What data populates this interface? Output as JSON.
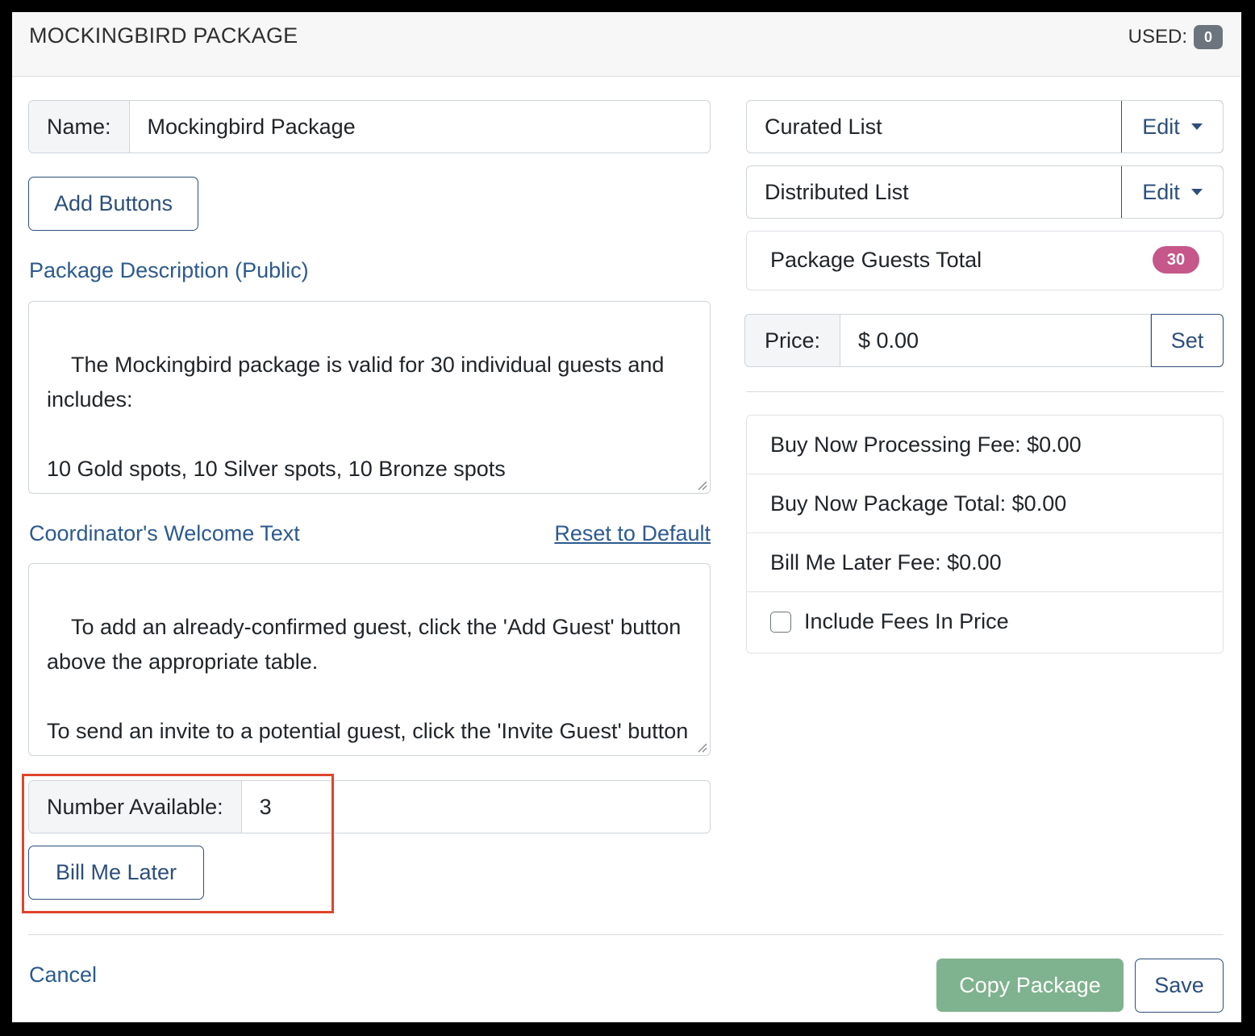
{
  "header": {
    "title": "MOCKINGBIRD PACKAGE",
    "used_label": "USED:",
    "used_count": "0"
  },
  "name_field": {
    "label": "Name:",
    "value": "Mockingbird Package"
  },
  "add_buttons_label": "Add Buttons",
  "description": {
    "label": "Package Description (Public)",
    "text": "The Mockingbird package is valid for 30 individual guests and includes:\n\n10 Gold spots, 10 Silver spots, 10 Bronze spots"
  },
  "welcome": {
    "label": "Coordinator's Welcome Text",
    "reset_label": "Reset to Default",
    "text": "To add an already-confirmed guest, click the 'Add Guest' button above the appropriate table.\n\nTo send an invite to a potential guest, click the 'Invite Guest' button above the appropriate table. The guest will receive an"
  },
  "number_available": {
    "label": "Number Available:",
    "value": "3"
  },
  "bill_me_later_label": "Bill Me Later",
  "lists": {
    "curated": {
      "label": "Curated List",
      "edit_label": "Edit"
    },
    "distributed": {
      "label": "Distributed List",
      "edit_label": "Edit"
    }
  },
  "guests_total": {
    "label": "Package Guests Total",
    "count": "30"
  },
  "price": {
    "label": "Price:",
    "value": "$ 0.00",
    "set_label": "Set"
  },
  "fees": {
    "processing": "Buy Now Processing Fee: $0.00",
    "package_total": "Buy Now Package Total: $0.00",
    "bill_later_fee": "Bill Me Later Fee: $0.00",
    "include_fees_label": "Include Fees In Price"
  },
  "footer": {
    "cancel_label": "Cancel",
    "copy_label": "Copy Package",
    "save_label": "Save"
  },
  "colors": {
    "accent": "#2c4f7c",
    "badge": "#c5578a",
    "copy_button": "#7fb28e",
    "highlight": "#e0442c"
  }
}
